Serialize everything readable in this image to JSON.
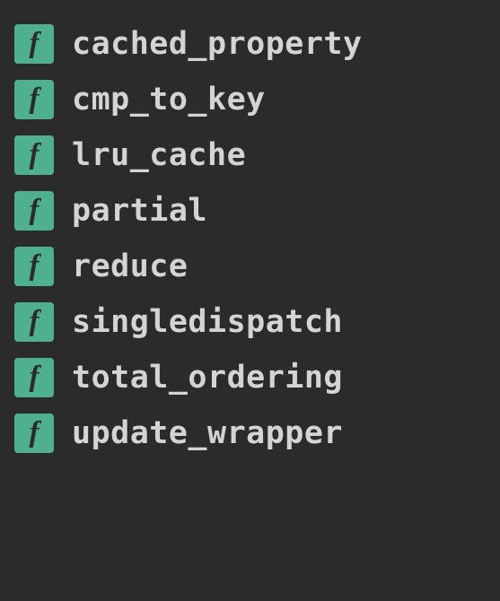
{
  "icon_glyph": "f",
  "items": [
    {
      "label": "cached_property"
    },
    {
      "label": "cmp_to_key"
    },
    {
      "label": "lru_cache"
    },
    {
      "label": "partial"
    },
    {
      "label": "reduce"
    },
    {
      "label": "singledispatch"
    },
    {
      "label": "total_ordering"
    },
    {
      "label": "update_wrapper"
    }
  ]
}
